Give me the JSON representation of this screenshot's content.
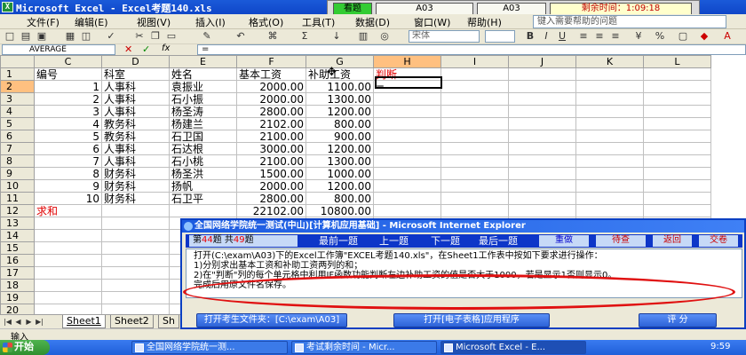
{
  "window": {
    "title": "Microsoft Excel - Excel考题140.xls"
  },
  "exam_bar": {
    "label_view": "看题",
    "cell1": "A03",
    "cell2": "A03",
    "remaining_label": "剩余时间：",
    "remaining_time": "1:09:18"
  },
  "menu": {
    "items": [
      "文件(F)",
      "编辑(E)",
      "视图(V)",
      "插入(I)",
      "格式(O)",
      "工具(T)",
      "数据(D)",
      "窗口(W)",
      "帮助(H)"
    ],
    "help_placeholder": "键入需要帮助的问题",
    "font_name": "宋体"
  },
  "formula_bar": {
    "name_box": "AVERAGE",
    "cancel": "✕",
    "enter": "✓",
    "fx": "fx",
    "eq": "="
  },
  "sheet": {
    "col_headers": [
      "",
      "C",
      "D",
      "E",
      "F",
      "G",
      "H",
      "I",
      "J",
      "K",
      "L"
    ],
    "rows": [
      {
        "r": "1",
        "c": [
          "编号",
          "科室",
          "姓名",
          "基本工资",
          "补助工资",
          "判断",
          "",
          "",
          "",
          ""
        ]
      },
      {
        "r": "2",
        "c": [
          "1",
          "人事科",
          "袁振业",
          "2000.00",
          "1100.00",
          "=",
          "",
          "",
          "",
          ""
        ]
      },
      {
        "r": "3",
        "c": [
          "2",
          "人事科",
          "石小振",
          "2000.00",
          "1300.00",
          "",
          "",
          "",
          "",
          ""
        ]
      },
      {
        "r": "4",
        "c": [
          "3",
          "人事科",
          "杨圣涛",
          "2800.00",
          "1200.00",
          "",
          "",
          "",
          "",
          ""
        ]
      },
      {
        "r": "5",
        "c": [
          "4",
          "教务科",
          "杨建兰",
          "2102.00",
          "800.00",
          "",
          "",
          "",
          "",
          ""
        ]
      },
      {
        "r": "6",
        "c": [
          "5",
          "教务科",
          "石卫国",
          "2100.00",
          "900.00",
          "",
          "",
          "",
          "",
          ""
        ]
      },
      {
        "r": "7",
        "c": [
          "6",
          "人事科",
          "石达根",
          "3000.00",
          "1200.00",
          "",
          "",
          "",
          "",
          ""
        ]
      },
      {
        "r": "8",
        "c": [
          "7",
          "人事科",
          "石小桃",
          "2100.00",
          "1300.00",
          "",
          "",
          "",
          "",
          ""
        ]
      },
      {
        "r": "9",
        "c": [
          "8",
          "财务科",
          "杨圣洪",
          "1500.00",
          "1000.00",
          "",
          "",
          "",
          "",
          ""
        ]
      },
      {
        "r": "10",
        "c": [
          "9",
          "财务科",
          "扬帆",
          "2000.00",
          "1200.00",
          "",
          "",
          "",
          "",
          ""
        ]
      },
      {
        "r": "11",
        "c": [
          "10",
          "财务科",
          "石卫平",
          "2800.00",
          "800.00",
          "",
          "",
          "",
          "",
          ""
        ]
      },
      {
        "r": "12",
        "c": [
          "求和",
          "",
          "",
          "22102.00",
          "10800.00",
          "",
          "",
          "",
          "",
          ""
        ]
      },
      {
        "r": "13",
        "c": [
          "",
          "",
          "",
          "",
          "",
          "",
          "",
          "",
          "",
          ""
        ]
      },
      {
        "r": "14",
        "c": [
          "",
          "",
          "",
          "",
          "",
          "",
          "",
          "",
          "",
          ""
        ]
      },
      {
        "r": "15",
        "c": [
          "",
          "",
          "",
          "",
          "",
          "",
          "",
          "",
          "",
          ""
        ]
      },
      {
        "r": "16",
        "c": [
          "",
          "",
          "",
          "",
          "",
          "",
          "",
          "",
          "",
          ""
        ]
      },
      {
        "r": "17",
        "c": [
          "",
          "",
          "",
          "",
          "",
          "",
          "",
          "",
          "",
          ""
        ]
      },
      {
        "r": "18",
        "c": [
          "",
          "",
          "",
          "",
          "",
          "",
          "",
          "",
          "",
          ""
        ]
      },
      {
        "r": "19",
        "c": [
          "",
          "",
          "",
          "",
          "",
          "",
          "",
          "",
          "",
          ""
        ]
      },
      {
        "r": "20",
        "c": [
          "",
          "",
          "",
          "",
          "",
          "",
          "",
          "",
          "",
          ""
        ]
      }
    ]
  },
  "sheet_tabs": [
    "Sheet1",
    "Sheet2",
    "Sh"
  ],
  "status": {
    "mode": "输入"
  },
  "dialog": {
    "title": "全国网络学院统一测试(中山)[计算机应用基础] - Microsoft Internet Explorer",
    "q_prefix": "第",
    "q_current": "44",
    "q_mid": "题  共",
    "q_total": "49",
    "q_suffix": "题",
    "nav": [
      "最前一题",
      "上一题",
      "下一题",
      "最后一题"
    ],
    "boxes": [
      "重做",
      "待查",
      "返回",
      "交卷"
    ],
    "lines": [
      "打开(C:\\exam\\A03)下的Excel工作簿\"EXCEL考题140.xls\"，在Sheet1工作表中按如下要求进行操作：",
      "1)分别求出基本工资和补助工资两列的和；",
      "2)在\"判断\"列的每个单元格中利用IF函数功能判断左边补助工资的值是否大于1000，若是显示1否则显示0。",
      "完成后用原文件名保存。"
    ],
    "btn_open_folder": "打开考生文件夹：[C:\\exam\\A03]",
    "btn_open_app": "打开[电子表格]应用程序",
    "btn_score": "评  分"
  },
  "taskbar": {
    "start": "开始",
    "tasks": [
      "全国网络学院统一测...",
      "考试剩余时间 - Micr...",
      "Microsoft Excel - E..."
    ],
    "time": "9:59"
  }
}
